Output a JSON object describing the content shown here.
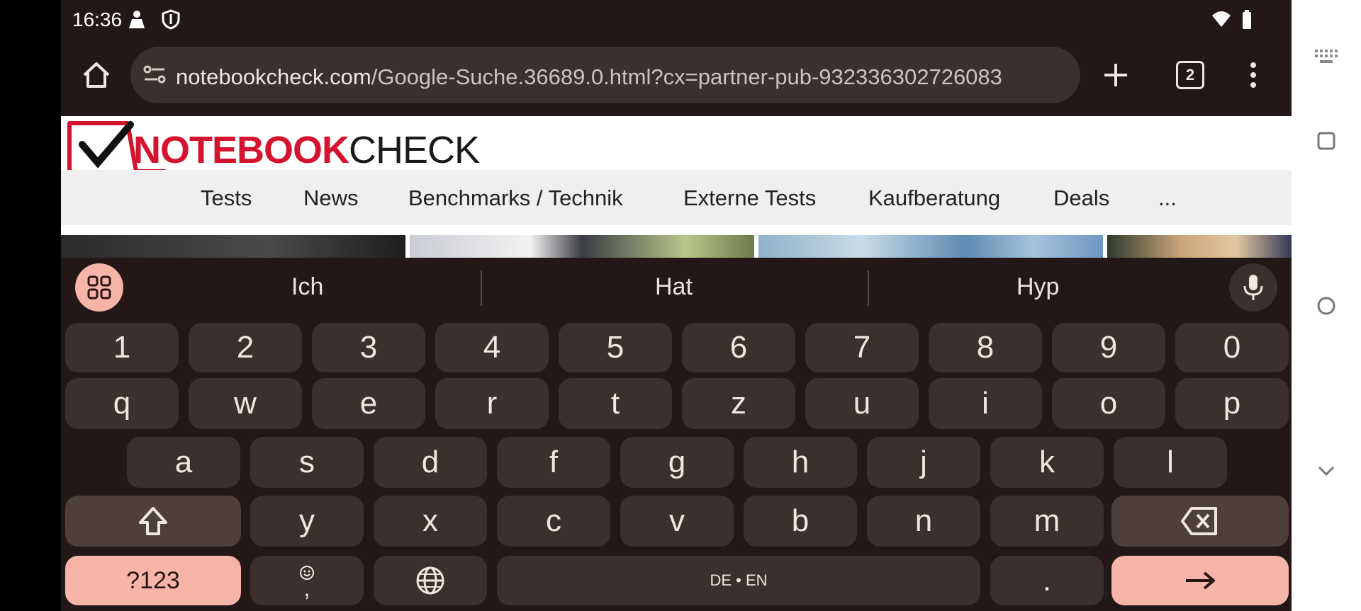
{
  "status_bar": {
    "time": "16:36"
  },
  "browser": {
    "url_domain": "notebookcheck.com",
    "url_path": "/Google-Suche.36689.0.html?cx=partner-pub-932336302726083",
    "tab_count": "2"
  },
  "page": {
    "logo_red": "NOTEBOOK",
    "logo_black": "CHECK",
    "nav_items": [
      "Tests",
      "News",
      "Benchmarks / Technik",
      "Externe Tests",
      "Kaufberatung",
      "Deals",
      "..."
    ]
  },
  "keyboard": {
    "suggestions": [
      "Ich",
      "Hat",
      "Hyp"
    ],
    "row_numbers": [
      "1",
      "2",
      "3",
      "4",
      "5",
      "6",
      "7",
      "8",
      "9",
      "0"
    ],
    "row1": [
      "q",
      "w",
      "e",
      "r",
      "t",
      "z",
      "u",
      "i",
      "o",
      "p"
    ],
    "row2": [
      "a",
      "s",
      "d",
      "f",
      "g",
      "h",
      "j",
      "k",
      "l"
    ],
    "row3": [
      "y",
      "x",
      "c",
      "v",
      "b",
      "n",
      "m"
    ],
    "symbols_label": "?123",
    "comma_label": ",",
    "space_label": "DE • EN",
    "period_label": "."
  },
  "colors": {
    "keyboard_bg": "#231817",
    "key_bg": "#3c2f2d",
    "accent": "#f7b4a9",
    "brand_red": "#d4142e"
  }
}
